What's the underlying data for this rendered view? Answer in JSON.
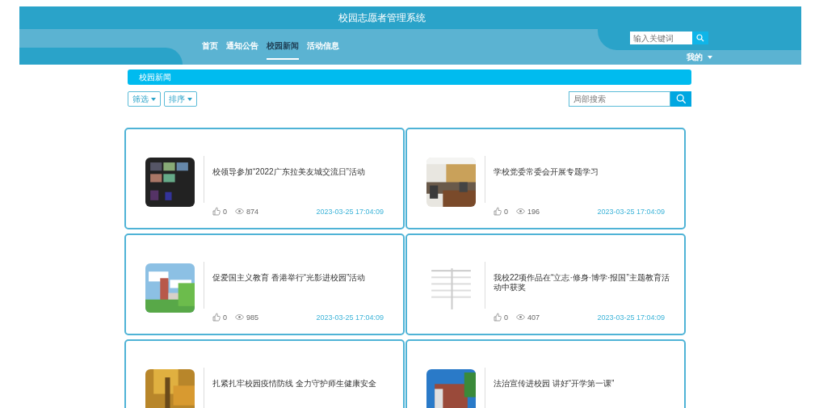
{
  "header": {
    "title": "校园志愿者管理系统",
    "nav": [
      {
        "label": "首页",
        "selected": false
      },
      {
        "label": "通知公告",
        "selected": false
      },
      {
        "label": "校园新闻",
        "selected": true
      },
      {
        "label": "活动信息",
        "selected": false
      }
    ],
    "search": {
      "placeholder": "输入关键词"
    },
    "user_menu": "我的"
  },
  "section": {
    "title": "校园新闻"
  },
  "toolbar": {
    "filters": [
      "筛选",
      "排序"
    ],
    "search": {
      "placeholder": "局部搜索"
    }
  },
  "news": [
    {
      "title": "校领导参加“2022广东拉美友城交流日”活动",
      "likes": "0",
      "views": "874",
      "date": "2023-03-25 17:04:09"
    },
    {
      "title": "学校党委常委会开展专题学习",
      "likes": "0",
      "views": "196",
      "date": "2023-03-25 17:04:09"
    },
    {
      "title": "促爱国主义教育 香港举行“光影进校园”活动",
      "likes": "0",
      "views": "985",
      "date": "2023-03-25 17:04:09"
    },
    {
      "title": "我校22项作品在“立志·修身·博学·报国”主题教育活动中获奖",
      "likes": "0",
      "views": "407",
      "date": "2023-03-25 17:04:09"
    },
    {
      "title": "扎紧扎牢校园疫情防线 全力守护师生健康安全"
    },
    {
      "title": "法治宣传进校园 讲好“开学第一课”"
    }
  ]
}
